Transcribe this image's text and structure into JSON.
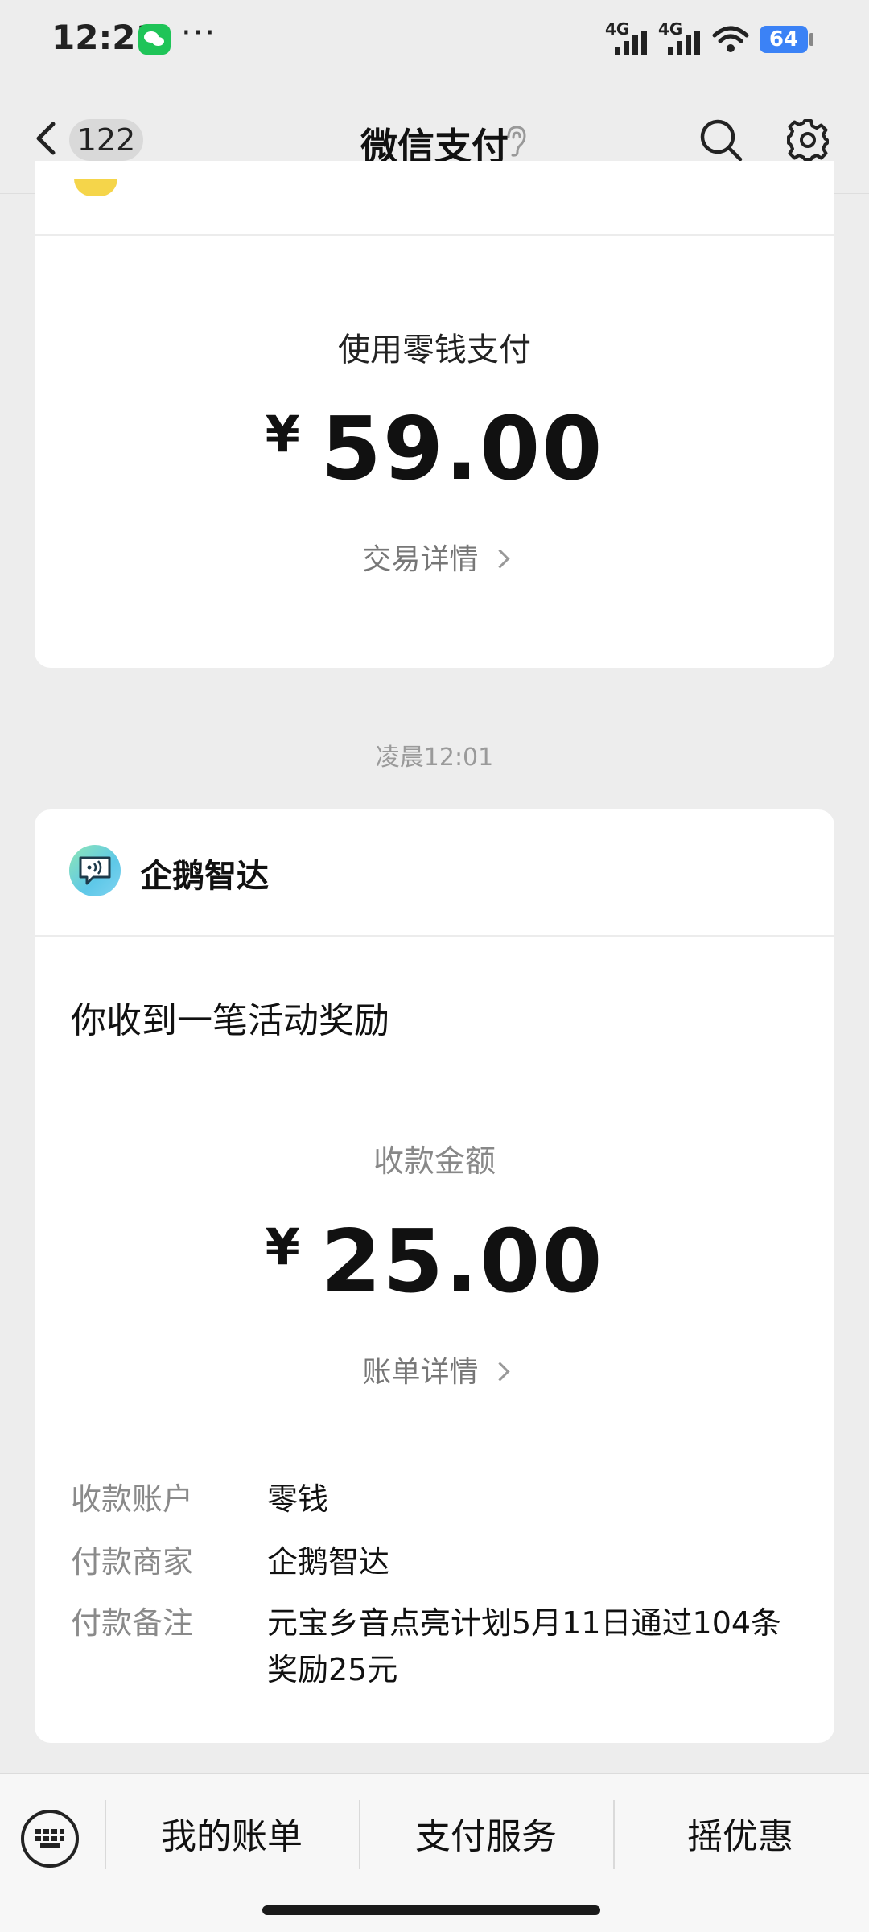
{
  "status_bar": {
    "time": "12:21",
    "more": "···",
    "network1": "4G",
    "network2": "4G",
    "battery": "64"
  },
  "header": {
    "unread_count": "122",
    "title": "微信支付"
  },
  "card1": {
    "pay_method": "使用零钱支付",
    "currency": "¥",
    "amount": "59.00",
    "detail_link": "交易详情"
  },
  "timestamp": "凌晨12:01",
  "card2": {
    "merchant": "企鹅智达",
    "notice": "你收到一笔活动奖励",
    "amount_label": "收款金额",
    "currency": "¥",
    "amount": "25.00",
    "detail_link": "账单详情",
    "rows": [
      {
        "key": "收款账户",
        "value": "零钱"
      },
      {
        "key": "付款商家",
        "value": "企鹅智达"
      },
      {
        "key": "付款备注",
        "value": "元宝乡音点亮计划5月11日通过104条奖励25元"
      }
    ]
  },
  "bottom_menu": {
    "items": [
      "我的账单",
      "支付服务",
      "摇优惠"
    ]
  },
  "colors": {
    "background": "#ededed",
    "card": "#ffffff",
    "wechat_green": "#1fc458",
    "battery_blue": "#3b82f6"
  }
}
